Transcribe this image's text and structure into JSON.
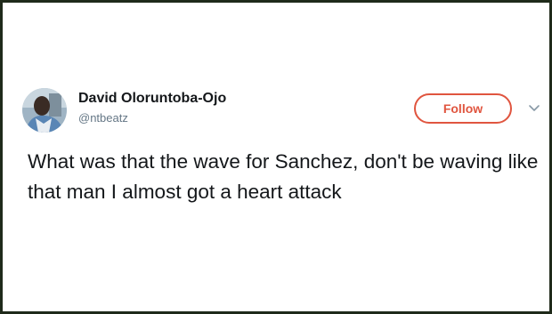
{
  "tweet": {
    "author": {
      "display_name": "David Oloruntoba-Ojo",
      "handle": "@ntbeatz",
      "avatar_icon": "profile-photo"
    },
    "follow_label": "Follow",
    "accent_color": "#e0553f",
    "menu_icon": "chevron-down-icon",
    "text": "What was that the wave for Sanchez, don't be waving like that man I almost got a heart attack"
  }
}
